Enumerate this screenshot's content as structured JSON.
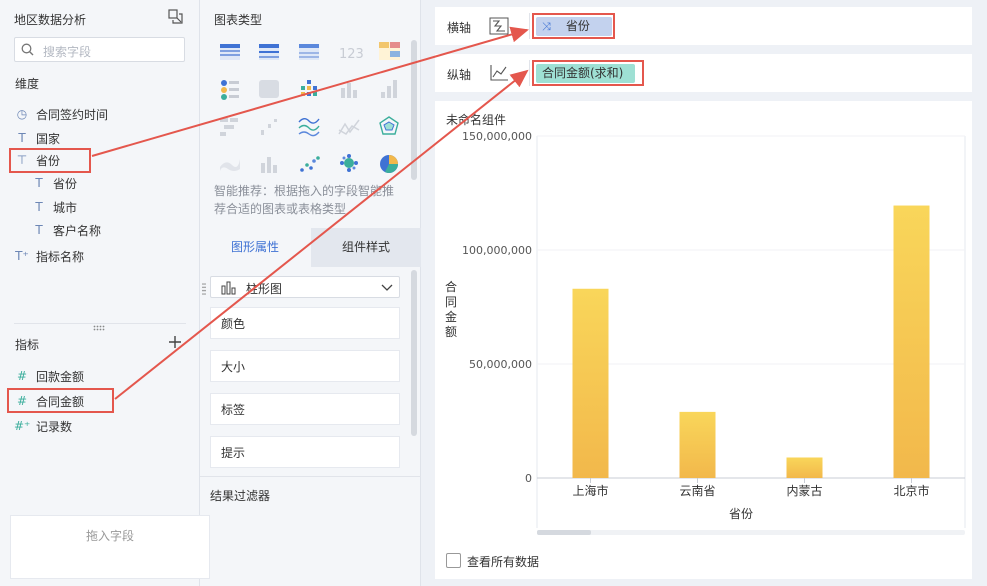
{
  "left_panel": {
    "title": "地区数据分析",
    "search_placeholder": "搜索字段",
    "dimension_title": "维度",
    "dimensions": [
      {
        "label": "合同签约时间",
        "icon": "clock-icon",
        "glyph": "◷"
      },
      {
        "label": "国家",
        "icon": "text-type-icon",
        "glyph": "T"
      },
      {
        "label": "省份",
        "icon": "hierarchy-icon",
        "glyph": "⊤"
      },
      {
        "label": "省份",
        "icon": "text-type-icon",
        "glyph": "T"
      },
      {
        "label": "城市",
        "icon": "text-type-icon",
        "glyph": "T"
      },
      {
        "label": "客户名称",
        "icon": "text-type-icon",
        "glyph": "T"
      },
      {
        "label": "指标名称",
        "icon": "text-type-plus-icon",
        "glyph": "T⁺"
      }
    ],
    "metric_title": "指标",
    "metrics": [
      {
        "label": "回款金额",
        "icon": "number-type-icon",
        "glyph": "#"
      },
      {
        "label": "合同金额",
        "icon": "number-type-icon",
        "glyph": "#"
      },
      {
        "label": "记录数",
        "icon": "number-type-plus-icon",
        "glyph": "#⁺"
      }
    ]
  },
  "mid_panel": {
    "chart_type_title": "图表类型",
    "smart_tip": "智能推荐：根据拖入的字段智能推荐合适的图表或表格类型",
    "tabs": {
      "graph_props": "图形属性",
      "component_style": "组件样式"
    },
    "chart_type_select": "柱形图",
    "properties": [
      "颜色",
      "大小",
      "标签",
      "提示"
    ],
    "filter_title": "结果过滤器",
    "drop_zone": "拖入字段"
  },
  "right_panel": {
    "x_axis_label": "横轴",
    "x_axis_field": "省份",
    "y_axis_label": "纵轴",
    "y_axis_field": "合同金额(求和)",
    "chart_title": "未命名组件",
    "show_all_data": "查看所有数据"
  },
  "colors": {
    "accent_blue": "#3f72d4",
    "pill_x": "#c3d2ee",
    "pill_y": "#9ee0d4",
    "annotation_red": "#e4574d",
    "bar_top": "#f9d65a",
    "bar_bottom": "#f2b84b"
  },
  "chart_data": {
    "type": "bar",
    "categories": [
      "上海市",
      "云南省",
      "内蒙古",
      "北京市"
    ],
    "values": [
      83000000,
      29000000,
      9000000,
      119500000
    ],
    "xlabel": "省份",
    "ylabel": "合同金额",
    "ylim": [
      0,
      150000000
    ],
    "yticks": [
      "0",
      "50,000,000",
      "100,000,000",
      "150,000,000"
    ],
    "grid": true
  }
}
